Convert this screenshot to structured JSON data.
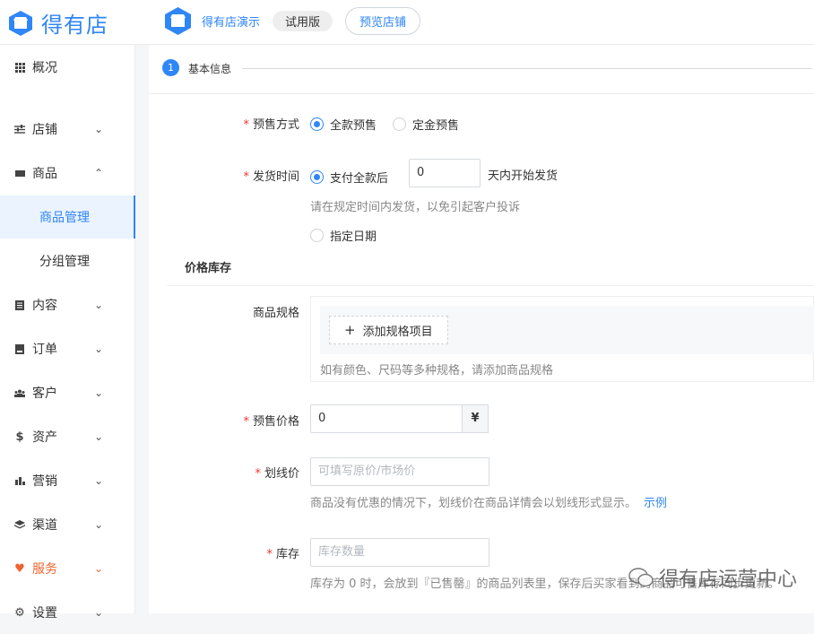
{
  "header": {
    "logo_text": "得有店",
    "shop_name": "得有店演示",
    "trial_badge": "试用版",
    "preview_button": "预览店铺"
  },
  "sidebar": {
    "items": [
      {
        "label": "概况",
        "icon": "grid-icon"
      },
      {
        "label": "店铺",
        "icon": "sliders-icon"
      },
      {
        "label": "商品",
        "icon": "product-icon"
      },
      {
        "label": "商品管理",
        "icon": ""
      },
      {
        "label": "分组管理",
        "icon": ""
      },
      {
        "label": "内容",
        "icon": "document-icon"
      },
      {
        "label": "订单",
        "icon": "order-icon"
      },
      {
        "label": "客户",
        "icon": "users-icon"
      },
      {
        "label": "资产",
        "icon": "dollar-icon"
      },
      {
        "label": "营销",
        "icon": "bar-chart-icon"
      },
      {
        "label": "渠道",
        "icon": "layers-icon"
      },
      {
        "label": "服务",
        "icon": "heart-icon"
      },
      {
        "label": "设置",
        "icon": "gear-icon"
      }
    ]
  },
  "steps": {
    "current_number": "1",
    "current_label": "基本信息"
  },
  "form": {
    "presale_mode": {
      "label": "预售方式",
      "options": [
        "全款预售",
        "定金预售"
      ],
      "selected": "全款预售"
    },
    "ship_time": {
      "label": "发货时间",
      "option_after_pay": "支付全款后",
      "days_value": "0",
      "days_suffix": "天内开始发货",
      "help": "请在规定时间内发货，以免引起客户投诉",
      "option_date": "指定日期"
    },
    "price_stock_title": "价格库存",
    "spec": {
      "label": "商品规格",
      "add_button": "添加规格项目",
      "help": "如有颜色、尺码等多种规格，请添加商品规格"
    },
    "presale_price": {
      "label": "预售价格",
      "value": "0",
      "currency": "¥"
    },
    "original_price": {
      "label": "划线价",
      "placeholder": "可填写原价/市场价",
      "help": "商品没有优惠的情况下，划线价在商品详情会以划线形式显示。",
      "example_link": "示例"
    },
    "stock": {
      "label": "库存",
      "placeholder": "库存数量",
      "help": "库存为 0 时，会放到『已售罄』的商品列表里，保存后买家看到的商品可售库存同步更新。"
    }
  },
  "watermark": "得有店运营中心",
  "colors": {
    "brand": "#2f86f6",
    "required": "#e33333",
    "service": "#f0632e"
  }
}
